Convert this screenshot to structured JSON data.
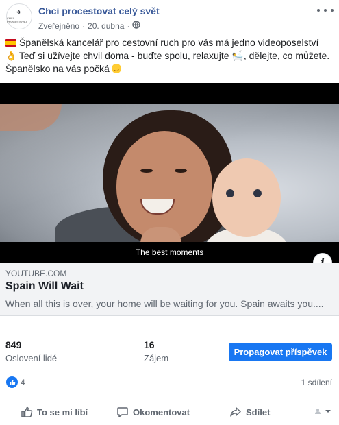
{
  "post": {
    "page_name": "Chci procestovat celý svět",
    "avatar_logo_mark": "✈",
    "avatar_logo_text": "CHCI PROCESTOVAT",
    "status": "Zveřejněno",
    "separator": "·",
    "date": "20. dubna",
    "text_line1": "Španělská kancelář pro cestovní ruch pro vás má jedno videoposelství",
    "text_line2": "Teď si užívejte chvil doma - buďte spolu, relaxujte 🛀, dělejte, co můžete.",
    "text_line3": "Španělsko na vás počká",
    "emoji_hand": "👌"
  },
  "video": {
    "subtitle": "The best moments",
    "info_glyph": "i"
  },
  "link_preview": {
    "domain": "YOUTUBE.COM",
    "title": "Spain Will Wait",
    "description": "When all this is over, your home will be waiting for you. Spain awaits you...."
  },
  "insights": {
    "reach_value": "849",
    "reach_label": "Oslovení lidé",
    "engagement_value": "16",
    "engagement_label": "Zájem",
    "boost_label": "Propagovat příspěvek"
  },
  "reactions": {
    "count": "4",
    "shares": "1 sdílení"
  },
  "actions": {
    "like": "To se mi líbí",
    "comment": "Okomentovat",
    "share": "Sdílet"
  },
  "colors": {
    "accent": "#1877f2",
    "page_name": "#385898",
    "muted_text": "#606770",
    "card_bg": "#f2f3f5"
  },
  "icons": [
    "globe-icon",
    "more-options-icon",
    "info-icon",
    "like-reaction-icon",
    "thumbs-up-icon",
    "comment-icon",
    "share-icon",
    "audience-selector-icon"
  ]
}
